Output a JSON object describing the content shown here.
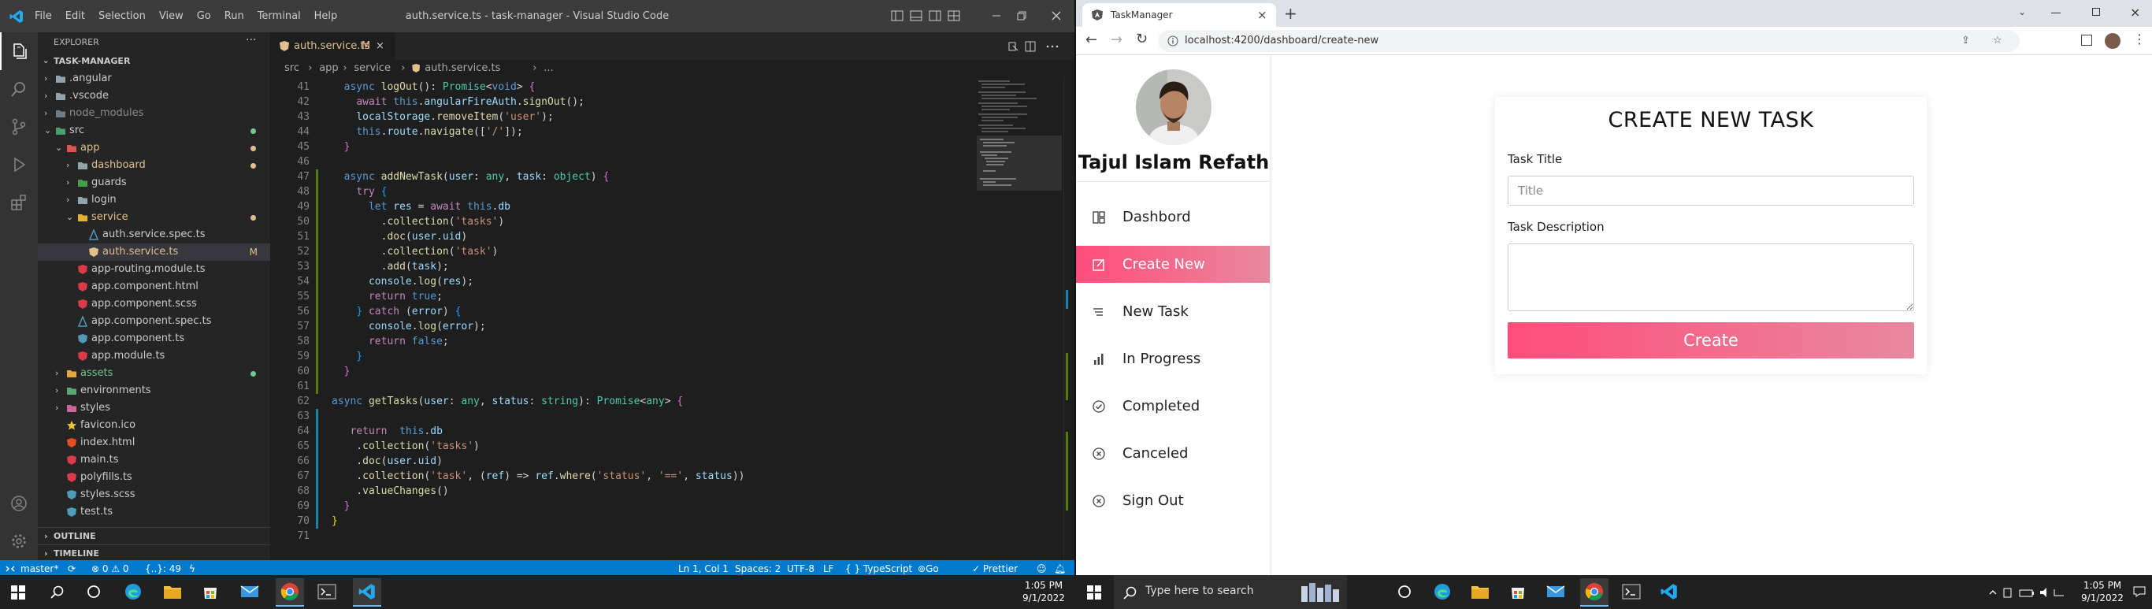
{
  "vscode": {
    "menu": [
      "File",
      "Edit",
      "Selection",
      "View",
      "Go",
      "Run",
      "Terminal",
      "Help"
    ],
    "window_title": "auth.service.ts - task-manager - Visual Studio Code",
    "explorer_label": "EXPLORER",
    "root_folder": "TASK-MANAGER",
    "tree": [
      {
        "label": ".angular",
        "indent": 1,
        "kind": "folder",
        "open": false
      },
      {
        "label": ".vscode",
        "indent": 1,
        "kind": "folder",
        "open": false
      },
      {
        "label": "node_modules",
        "indent": 1,
        "kind": "folder-dim",
        "open": false
      },
      {
        "label": "src",
        "indent": 1,
        "kind": "folder",
        "open": true,
        "dot": "#73c991"
      },
      {
        "label": "app",
        "indent": 2,
        "kind": "folder-mod",
        "open": true,
        "dot": "#e2c08d"
      },
      {
        "label": "dashboard",
        "indent": 3,
        "kind": "folder-mod",
        "open": false,
        "dot": "#e2c08d"
      },
      {
        "label": "guards",
        "indent": 3,
        "kind": "folder",
        "open": false
      },
      {
        "label": "login",
        "indent": 3,
        "kind": "folder",
        "open": false
      },
      {
        "label": "service",
        "indent": 3,
        "kind": "folder-mod",
        "open": true,
        "dot": "#e2c08d"
      },
      {
        "label": "auth.service.spec.ts",
        "indent": 4,
        "kind": "spec"
      },
      {
        "label": "auth.service.ts",
        "indent": 4,
        "kind": "ang-mod",
        "status": "M",
        "selected": true
      },
      {
        "label": "app-routing.module.ts",
        "indent": 3,
        "kind": "ang"
      },
      {
        "label": "app.component.html",
        "indent": 3,
        "kind": "ang"
      },
      {
        "label": "app.component.scss",
        "indent": 3,
        "kind": "ang"
      },
      {
        "label": "app.component.spec.ts",
        "indent": 3,
        "kind": "spec"
      },
      {
        "label": "app.component.ts",
        "indent": 3,
        "kind": "blue"
      },
      {
        "label": "app.module.ts",
        "indent": 3,
        "kind": "ang"
      },
      {
        "label": "assets",
        "indent": 2,
        "kind": "folder-new",
        "open": false,
        "dot": "#73c991"
      },
      {
        "label": "environments",
        "indent": 2,
        "kind": "folder",
        "open": false
      },
      {
        "label": "styles",
        "indent": 2,
        "kind": "folder",
        "open": false
      },
      {
        "label": "favicon.ico",
        "indent": 2,
        "kind": "star"
      },
      {
        "label": "index.html",
        "indent": 2,
        "kind": "html"
      },
      {
        "label": "main.ts",
        "indent": 2,
        "kind": "ang"
      },
      {
        "label": "polyfills.ts",
        "indent": 2,
        "kind": "ang"
      },
      {
        "label": "styles.scss",
        "indent": 2,
        "kind": "scss"
      },
      {
        "label": "test.ts",
        "indent": 2,
        "kind": "blue"
      }
    ],
    "outline_label": "OUTLINE",
    "timeline_label": "TIMELINE",
    "tab_label": "auth.service.ts",
    "tab_status": "M",
    "breadcrumb": [
      "src",
      "app",
      "service",
      "auth.service.ts",
      "..."
    ],
    "code_lines": [
      {
        "n": "41",
        "t": [
          [
            "  ",
            ""
          ],
          [
            "async ",
            "kw"
          ],
          [
            "logOut",
            "fn"
          ],
          [
            "(): ",
            ""
          ],
          [
            "Promise",
            "ty"
          ],
          [
            "<",
            ""
          ],
          [
            "void",
            "kw"
          ],
          [
            "> ",
            ""
          ],
          [
            "{",
            "br2"
          ]
        ]
      },
      {
        "n": "42",
        "t": [
          [
            "    ",
            ""
          ],
          [
            "await ",
            "ck"
          ],
          [
            "this",
            "kw"
          ],
          [
            ".",
            ""
          ],
          [
            "angularFireAuth",
            "vr"
          ],
          [
            ".",
            ""
          ],
          [
            "signOut",
            "fn"
          ],
          [
            "();",
            ""
          ]
        ]
      },
      {
        "n": "43",
        "t": [
          [
            "    ",
            ""
          ],
          [
            "localStorage",
            "vr"
          ],
          [
            ".",
            ""
          ],
          [
            "removeItem",
            "fn"
          ],
          [
            "(",
            ""
          ],
          [
            "'user'",
            "st2"
          ],
          [
            ");",
            ""
          ]
        ]
      },
      {
        "n": "44",
        "t": [
          [
            "    ",
            ""
          ],
          [
            "this",
            "kw"
          ],
          [
            ".",
            ""
          ],
          [
            "route",
            "vr"
          ],
          [
            ".",
            ""
          ],
          [
            "navigate",
            "fn"
          ],
          [
            "([",
            ""
          ],
          [
            "'/'",
            "st2"
          ],
          [
            "]);",
            ""
          ]
        ]
      },
      {
        "n": "45",
        "t": [
          [
            "  ",
            ""
          ],
          [
            "}",
            "br2"
          ]
        ]
      },
      {
        "n": "46",
        "t": []
      },
      {
        "n": "47",
        "t": [
          [
            "  ",
            ""
          ],
          [
            "async ",
            "kw"
          ],
          [
            "addNewTask",
            "fn"
          ],
          [
            "(",
            ""
          ],
          [
            "user",
            "vr"
          ],
          [
            ": ",
            ""
          ],
          [
            "any",
            "ty"
          ],
          [
            ", ",
            ""
          ],
          [
            "task",
            "vr"
          ],
          [
            ": ",
            ""
          ],
          [
            "object",
            "ty"
          ],
          [
            ") ",
            ""
          ],
          [
            "{",
            "br2"
          ]
        ]
      },
      {
        "n": "48",
        "t": [
          [
            "    ",
            ""
          ],
          [
            "try ",
            "ck"
          ],
          [
            "{",
            "br3"
          ]
        ]
      },
      {
        "n": "49",
        "t": [
          [
            "      ",
            ""
          ],
          [
            "let ",
            "kw"
          ],
          [
            "res",
            "vr"
          ],
          [
            " = ",
            ""
          ],
          [
            "await ",
            "ck"
          ],
          [
            "this",
            "kw"
          ],
          [
            ".",
            ""
          ],
          [
            "db",
            "vr"
          ]
        ]
      },
      {
        "n": "50",
        "t": [
          [
            "        .",
            ""
          ],
          [
            "collection",
            "fn"
          ],
          [
            "(",
            ""
          ],
          [
            "'tasks'",
            "st2"
          ],
          [
            ")",
            ""
          ]
        ]
      },
      {
        "n": "51",
        "t": [
          [
            "        .",
            ""
          ],
          [
            "doc",
            "fn"
          ],
          [
            "(",
            ""
          ],
          [
            "user",
            "vr"
          ],
          [
            ".",
            ""
          ],
          [
            "uid",
            "vr"
          ],
          [
            ")",
            ""
          ]
        ]
      },
      {
        "n": "52",
        "t": [
          [
            "        .",
            ""
          ],
          [
            "collection",
            "fn"
          ],
          [
            "(",
            ""
          ],
          [
            "'task'",
            "st2"
          ],
          [
            ")",
            ""
          ]
        ]
      },
      {
        "n": "53",
        "t": [
          [
            "        .",
            ""
          ],
          [
            "add",
            "fn"
          ],
          [
            "(",
            ""
          ],
          [
            "task",
            "vr"
          ],
          [
            ");",
            ""
          ]
        ]
      },
      {
        "n": "54",
        "t": [
          [
            "      ",
            ""
          ],
          [
            "console",
            "vr"
          ],
          [
            ".",
            ""
          ],
          [
            "log",
            "fn"
          ],
          [
            "(",
            ""
          ],
          [
            "res",
            "vr"
          ],
          [
            ");",
            ""
          ]
        ]
      },
      {
        "n": "55",
        "t": [
          [
            "      ",
            ""
          ],
          [
            "return ",
            "ck"
          ],
          [
            "true",
            "kw"
          ],
          [
            ";",
            ""
          ]
        ]
      },
      {
        "n": "56",
        "t": [
          [
            "    ",
            ""
          ],
          [
            "} ",
            "br3"
          ],
          [
            "catch ",
            "ck"
          ],
          [
            "(",
            ""
          ],
          [
            "error",
            "vr"
          ],
          [
            ") ",
            ""
          ],
          [
            "{",
            "br3"
          ]
        ]
      },
      {
        "n": "57",
        "t": [
          [
            "      ",
            ""
          ],
          [
            "console",
            "vr"
          ],
          [
            ".",
            ""
          ],
          [
            "log",
            "fn"
          ],
          [
            "(",
            ""
          ],
          [
            "error",
            "vr"
          ],
          [
            ");",
            ""
          ]
        ]
      },
      {
        "n": "58",
        "t": [
          [
            "      ",
            ""
          ],
          [
            "return ",
            "ck"
          ],
          [
            "false",
            "kw"
          ],
          [
            ";",
            ""
          ]
        ]
      },
      {
        "n": "59",
        "t": [
          [
            "    ",
            ""
          ],
          [
            "}",
            "br3"
          ]
        ]
      },
      {
        "n": "60",
        "t": [
          [
            "  ",
            ""
          ],
          [
            "}",
            "br2"
          ]
        ]
      },
      {
        "n": "61",
        "t": []
      },
      {
        "n": "62",
        "t": [
          [
            "async ",
            "kw"
          ],
          [
            "getTasks",
            "fn"
          ],
          [
            "(",
            ""
          ],
          [
            "user",
            "vr"
          ],
          [
            ": ",
            ""
          ],
          [
            "any",
            "ty"
          ],
          [
            ", ",
            ""
          ],
          [
            "status",
            "vr"
          ],
          [
            ": ",
            ""
          ],
          [
            "string",
            "ty"
          ],
          [
            "): ",
            ""
          ],
          [
            "Promise",
            "ty"
          ],
          [
            "<",
            ""
          ],
          [
            "any",
            "ty"
          ],
          [
            "> ",
            ""
          ],
          [
            "{",
            "br2"
          ]
        ]
      },
      {
        "n": "63",
        "t": []
      },
      {
        "n": "64",
        "t": [
          [
            "   ",
            ""
          ],
          [
            "return  ",
            "ck"
          ],
          [
            "this",
            "kw"
          ],
          [
            ".",
            ""
          ],
          [
            "db",
            "vr"
          ]
        ]
      },
      {
        "n": "65",
        "t": [
          [
            "    .",
            ""
          ],
          [
            "collection",
            "fn"
          ],
          [
            "(",
            ""
          ],
          [
            "'tasks'",
            "st2"
          ],
          [
            ")",
            ""
          ]
        ]
      },
      {
        "n": "66",
        "t": [
          [
            "    .",
            ""
          ],
          [
            "doc",
            "fn"
          ],
          [
            "(",
            ""
          ],
          [
            "user",
            "vr"
          ],
          [
            ".",
            ""
          ],
          [
            "uid",
            "vr"
          ],
          [
            ")",
            ""
          ]
        ]
      },
      {
        "n": "67",
        "t": [
          [
            "    .",
            ""
          ],
          [
            "collection",
            "fn"
          ],
          [
            "(",
            ""
          ],
          [
            "'task'",
            "st2"
          ],
          [
            ", (",
            ""
          ],
          [
            "ref",
            "vr"
          ],
          [
            ") => ",
            ""
          ],
          [
            "ref",
            "vr"
          ],
          [
            ".",
            ""
          ],
          [
            "where",
            "fn"
          ],
          [
            "(",
            ""
          ],
          [
            "'status'",
            "st2"
          ],
          [
            ", ",
            ""
          ],
          [
            "'=='",
            "st2"
          ],
          [
            ", ",
            ""
          ],
          [
            "status",
            "vr"
          ],
          [
            "))",
            ""
          ]
        ]
      },
      {
        "n": "68",
        "t": [
          [
            "    .",
            ""
          ],
          [
            "valueChanges",
            "fn"
          ],
          [
            "()",
            ""
          ]
        ]
      },
      {
        "n": "69",
        "t": [
          [
            "  ",
            ""
          ],
          [
            "}",
            "br2"
          ]
        ]
      },
      {
        "n": "70",
        "t": [
          [
            "}",
            "br"
          ]
        ]
      },
      {
        "n": "71",
        "t": []
      }
    ],
    "status": {
      "branch": "master*",
      "problems": "⊗ 0 ⚠ 0",
      "chars": "{..}: 49",
      "position": "Ln 1, Col 1",
      "spaces": "Spaces: 2",
      "encoding": "UTF-8",
      "eol": "LF",
      "language": "{ } TypeScript",
      "golive": "Go Live",
      "prettier": "✓ Prettier"
    }
  },
  "chrome": {
    "tab_title": "TaskManager",
    "url": "localhost:4200/dashboard/create-new"
  },
  "app": {
    "user_name": "Tajul Islam Refath",
    "nav": [
      {
        "label": "Dashbord",
        "icon": "dashboard-icon",
        "active": false
      },
      {
        "label": "Create New",
        "icon": "edit-icon",
        "active": true
      },
      {
        "label": "New Task",
        "icon": "list-icon",
        "active": false
      },
      {
        "label": "In Progress",
        "icon": "bar-chart-icon",
        "active": false
      },
      {
        "label": "Completed",
        "icon": "check-circle-icon",
        "active": false
      },
      {
        "label": "Canceled",
        "icon": "x-circle-icon",
        "active": false
      },
      {
        "label": "Sign Out",
        "icon": "sign-out-icon",
        "active": false
      }
    ],
    "form": {
      "heading": "CREATE NEW TASK",
      "title_label": "Task Title",
      "title_placeholder": "Title",
      "desc_label": "Task Description",
      "button": "Create"
    },
    "accent_gradient": [
      "#ff4d7a",
      "#e8889f"
    ]
  },
  "taskbar": {
    "search_placeholder": "Type here to search",
    "time": "1:05 PM",
    "date": "9/1/2022"
  }
}
